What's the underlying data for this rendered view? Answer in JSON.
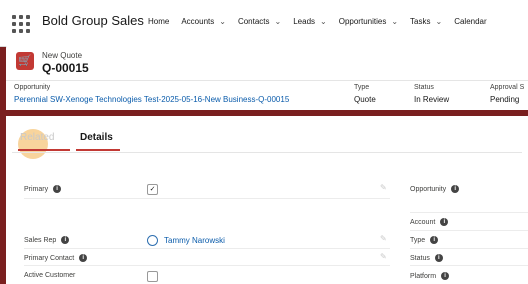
{
  "app": {
    "name": "Bold Group Sales"
  },
  "nav": {
    "items": [
      {
        "label": "Home",
        "dropdown": false
      },
      {
        "label": "Accounts",
        "dropdown": true
      },
      {
        "label": "Contacts",
        "dropdown": true
      },
      {
        "label": "Leads",
        "dropdown": true
      },
      {
        "label": "Opportunities",
        "dropdown": true
      },
      {
        "label": "Tasks",
        "dropdown": true
      },
      {
        "label": "Calendar",
        "dropdown": false
      }
    ]
  },
  "record": {
    "object_type": "New Quote",
    "name": "Q-00015",
    "icon": "cart-icon",
    "fields": {
      "opportunity_label": "Opportunity",
      "opportunity_value": "Perennial SW-Xenoge Technologies Test-2025-05-16-New Business-Q-00015",
      "type_label": "Type",
      "type_value": "Quote",
      "status_label": "Status",
      "status_value": "In Review",
      "approval_label": "Approval S",
      "approval_value": "Pending"
    }
  },
  "tabs": {
    "related": "Related",
    "details": "Details"
  },
  "details": {
    "primary_label": "Primary",
    "primary_checked": true,
    "sales_rep_label": "Sales Rep",
    "sales_rep_value": "Tammy Narowski",
    "primary_contact_label": "Primary Contact",
    "active_customer_label": "Active Customer",
    "active_customer_checked": false,
    "right": {
      "opportunity_label": "Opportunity",
      "account_label": "Account",
      "type_label": "Type",
      "status_label": "Status",
      "platform_label": "Platform"
    }
  },
  "colors": {
    "brand": "#7a1f1f",
    "accent": "#c23934",
    "link": "#0b5cab"
  }
}
